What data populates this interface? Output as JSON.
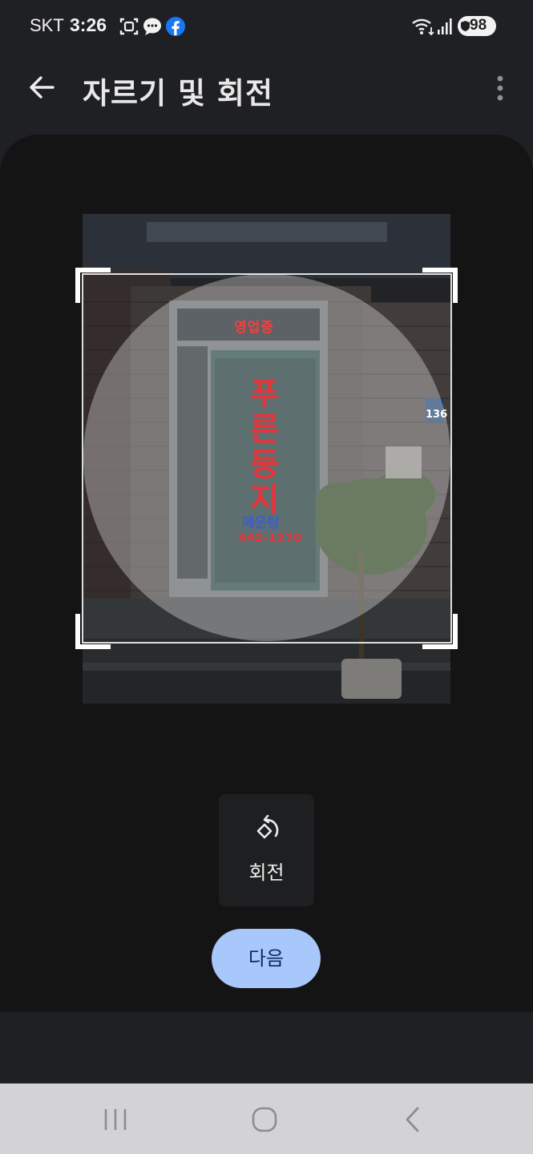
{
  "status_bar": {
    "carrier": "SKT",
    "time": "3:26",
    "battery": "98",
    "left_icons": [
      "screenshot-icon",
      "chat-bubble-icon",
      "facebook-icon"
    ],
    "right_icons": [
      "wifi-icon",
      "signal-icon",
      "battery-icon"
    ]
  },
  "app_bar": {
    "title": "자르기 및 회전",
    "back_icon": "arrow-back-icon",
    "more_icon": "more-vert-icon"
  },
  "photo": {
    "signs": {
      "led_text": "영업중",
      "store_name": "푸른둥지",
      "dish": "메운탕",
      "phone": "442-1270",
      "house_number": "136"
    }
  },
  "tools": {
    "rotate_label": "회전"
  },
  "next_label": "다음",
  "colors": {
    "background": "#1f2023",
    "panel": "#141415",
    "accent": "#a8c7fa",
    "accent_text": "#0b2a5c",
    "nav_bar": "#d3d3d6"
  }
}
